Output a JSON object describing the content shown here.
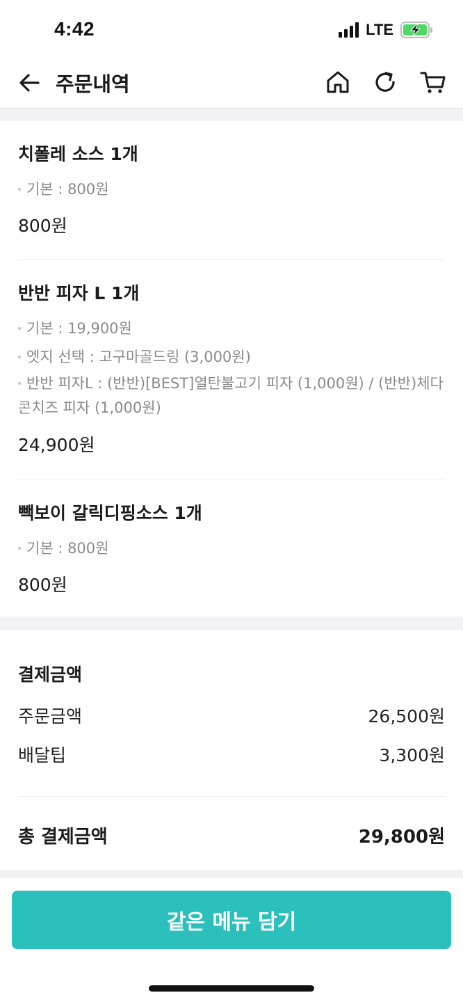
{
  "status_bar": {
    "time": "4:42",
    "network": "LTE",
    "signal_icon": "signal-bars-icon",
    "battery_icon": "battery-charging-icon",
    "battery_color": "#4cd964"
  },
  "header": {
    "title": "주문내역",
    "back_icon": "back-arrow-icon",
    "home_icon": "home-icon",
    "refresh_icon": "refresh-icon",
    "cart_icon": "cart-icon"
  },
  "order_items": [
    {
      "name": "치폴레 소스 1개",
      "options": [
        "기본 : 800원"
      ],
      "price": "800원"
    },
    {
      "name": "반반 피자 L 1개",
      "options": [
        "기본 : 19,900원",
        "엣지 선택 : 고구마골드링 (3,000원)",
        "반반 피자L : (반반)[BEST]열탄불고기 피자 (1,000원) / (반반)체다 콘치즈 피자 (1,000원)"
      ],
      "price": "24,900원"
    },
    {
      "name": "빽보이 갈릭디핑소스 1개",
      "options": [
        "기본 : 800원"
      ],
      "price": "800원"
    }
  ],
  "payment": {
    "title": "결제금액",
    "order_amount_label": "주문금액",
    "order_amount_value": "26,500원",
    "delivery_tip_label": "배달팁",
    "delivery_tip_value": "3,300원",
    "total_label": "총 결제금액",
    "total_value": "29,800원"
  },
  "actions": {
    "reorder_label": "같은 메뉴 담기",
    "accent_color": "#2bc0bb"
  }
}
